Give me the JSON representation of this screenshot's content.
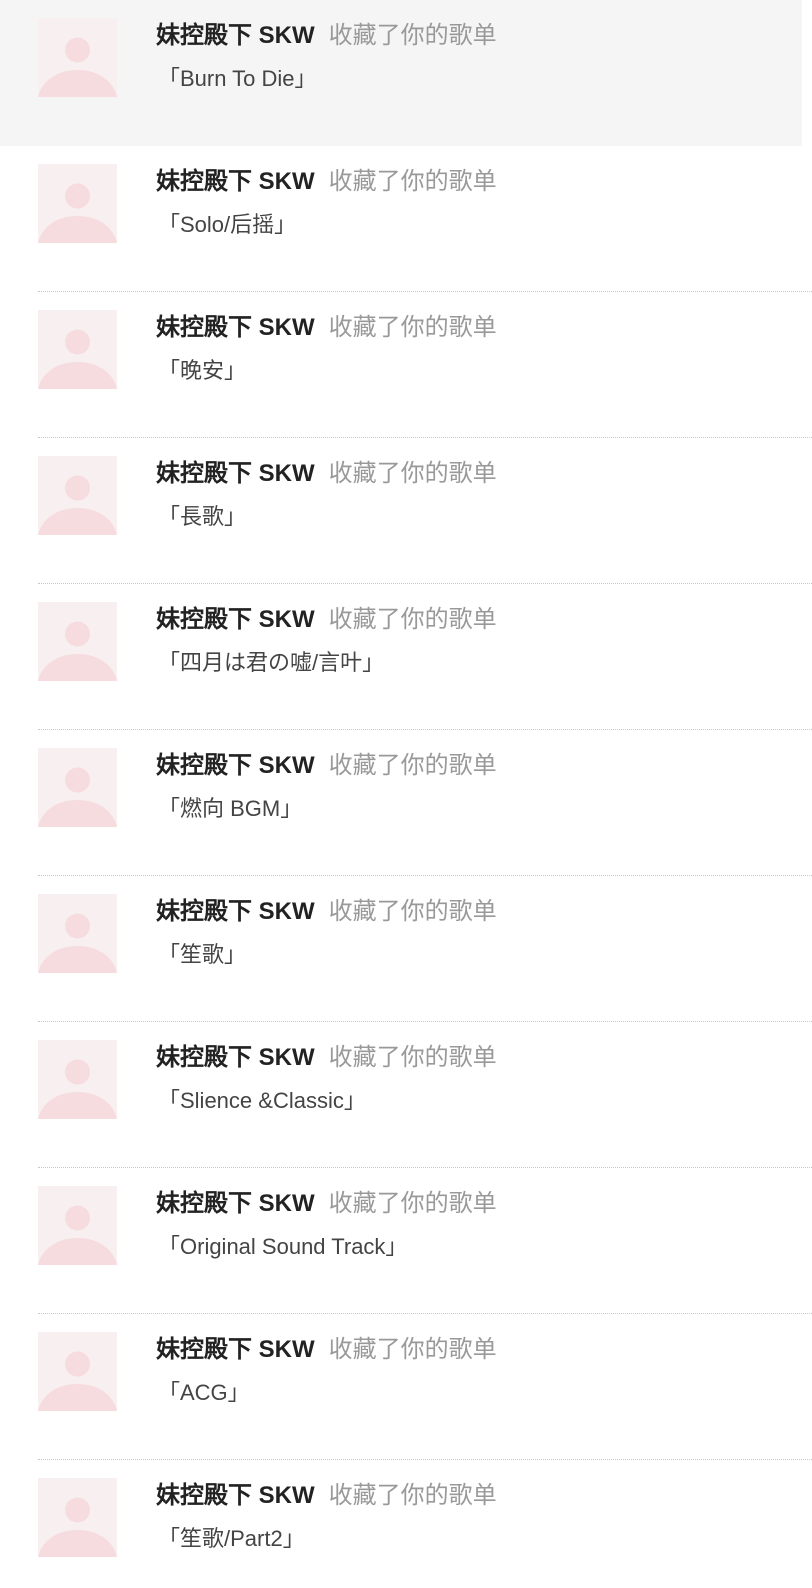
{
  "notifications": [
    {
      "user": "妹控殿下 SKW",
      "action": "收藏了你的歌单",
      "playlist": "「Burn To Die」",
      "highlighted": true
    },
    {
      "user": "妹控殿下 SKW",
      "action": "收藏了你的歌单",
      "playlist": "「Solo/后摇」",
      "highlighted": false
    },
    {
      "user": "妹控殿下 SKW",
      "action": "收藏了你的歌单",
      "playlist": "「晚安」",
      "highlighted": false
    },
    {
      "user": "妹控殿下 SKW",
      "action": "收藏了你的歌单",
      "playlist": "「長歌」",
      "highlighted": false
    },
    {
      "user": "妹控殿下 SKW",
      "action": "收藏了你的歌单",
      "playlist": "「四月は君の嘘/言叶」",
      "highlighted": false
    },
    {
      "user": "妹控殿下 SKW",
      "action": "收藏了你的歌单",
      "playlist": "「燃向 BGM」",
      "highlighted": false
    },
    {
      "user": "妹控殿下 SKW",
      "action": "收藏了你的歌单",
      "playlist": "「笙歌」",
      "highlighted": false
    },
    {
      "user": "妹控殿下 SKW",
      "action": "收藏了你的歌单",
      "playlist": "「Slience &Classic」",
      "highlighted": false
    },
    {
      "user": "妹控殿下 SKW",
      "action": "收藏了你的歌单",
      "playlist": "「Original Sound Track」",
      "highlighted": false
    },
    {
      "user": "妹控殿下 SKW",
      "action": "收藏了你的歌单",
      "playlist": "「ACG」",
      "highlighted": false
    },
    {
      "user": "妹控殿下 SKW",
      "action": "收藏了你的歌单",
      "playlist": "「笙歌/Part2」",
      "highlighted": false
    }
  ],
  "avatar": {
    "icon": "default-user-avatar-icon",
    "background": "#f7eff0",
    "figure": "#f6dcde"
  },
  "colors": {
    "highlight": "#f5f5f5",
    "username": "#222222",
    "action": "#999999",
    "playlist": "#444444",
    "divider": "#c8c8c8"
  }
}
